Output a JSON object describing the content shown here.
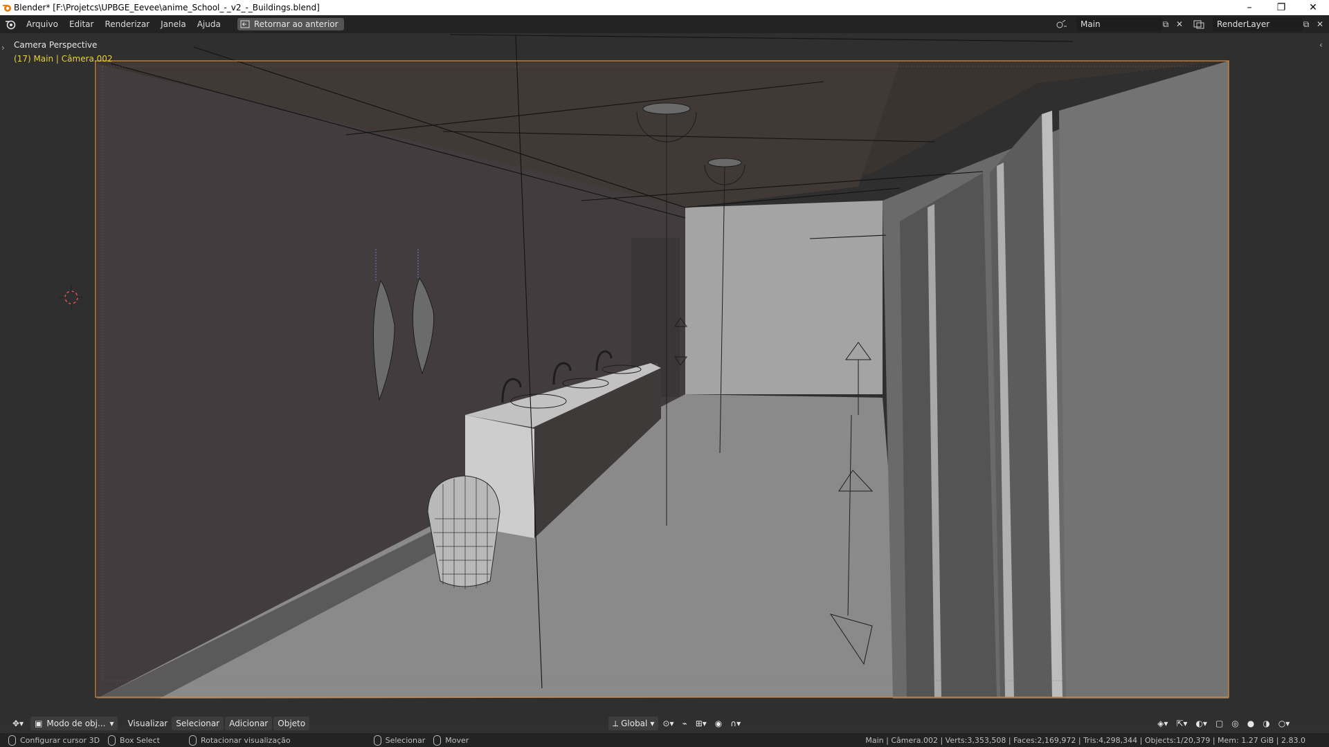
{
  "window": {
    "title": "Blender* [F:\\Projetcs\\UPBGE_Eevee\\anime_School_-_v2_-_Buildings.blend]"
  },
  "menu": {
    "items": [
      "Arquivo",
      "Editar",
      "Renderizar",
      "Janela",
      "Ajuda"
    ],
    "back_button": "Retornar ao anterior"
  },
  "topbar_right": {
    "scene": "Main",
    "view_layer": "RenderLayer"
  },
  "viewport": {
    "view_name": "Camera Perspective",
    "active_info": "(17) Main | Câmera.002"
  },
  "header3d": {
    "mode": "Modo de obj...",
    "menus": [
      "Visualizar",
      "Selecionar",
      "Adicionar",
      "Objeto"
    ],
    "orientation": "Global"
  },
  "statusbar": {
    "left_items": [
      "Configurar cursor 3D",
      "Box Select",
      "Rotacionar visualização"
    ],
    "middle_items": [
      "Selecionar",
      "Mover"
    ],
    "stats": "Main | Câmera.002 | Verts:3,353,508 | Faces:2,169,972 | Tris:4,298,344 | Objects:1/20,379 | Mem: 1.27 GiB | 2.83.0"
  },
  "colors": {
    "accent_frame": "#d48a3a",
    "active_text": "#e8d23a",
    "ui_dark": "#232323"
  }
}
